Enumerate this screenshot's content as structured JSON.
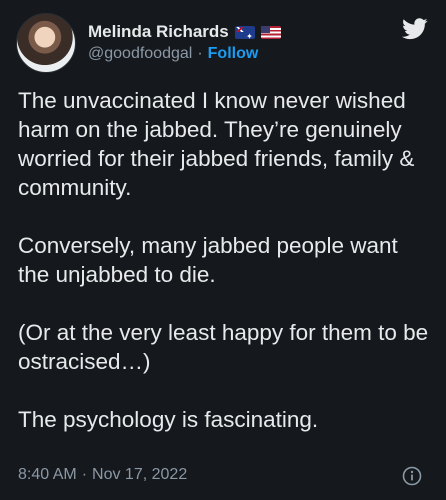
{
  "author": {
    "display_name": "Melinda Richards",
    "handle": "@goodfoodgal",
    "separator": "·",
    "follow_label": "Follow",
    "flags": [
      "australia-flag-icon",
      "us-flag-icon"
    ]
  },
  "tweet": {
    "text": "The unvaccinated I know never wished harm on the jabbed. They’re genuinely worried for their jabbed friends, family & community.\n\nConversely, many jabbed people want the unjabbed to die.\n\n(Or at the very least happy for them to be ostracised…)\n\nThe psychology is fascinating."
  },
  "footer": {
    "time": "8:40 AM",
    "separator": "·",
    "date": "Nov 17, 2022"
  },
  "icons": {
    "brand": "twitter-bird-icon",
    "info": "info-icon"
  },
  "colors": {
    "background": "#15181c",
    "text": "#e7e9ea",
    "muted": "#8b98a5",
    "accent": "#1d9bf0"
  }
}
